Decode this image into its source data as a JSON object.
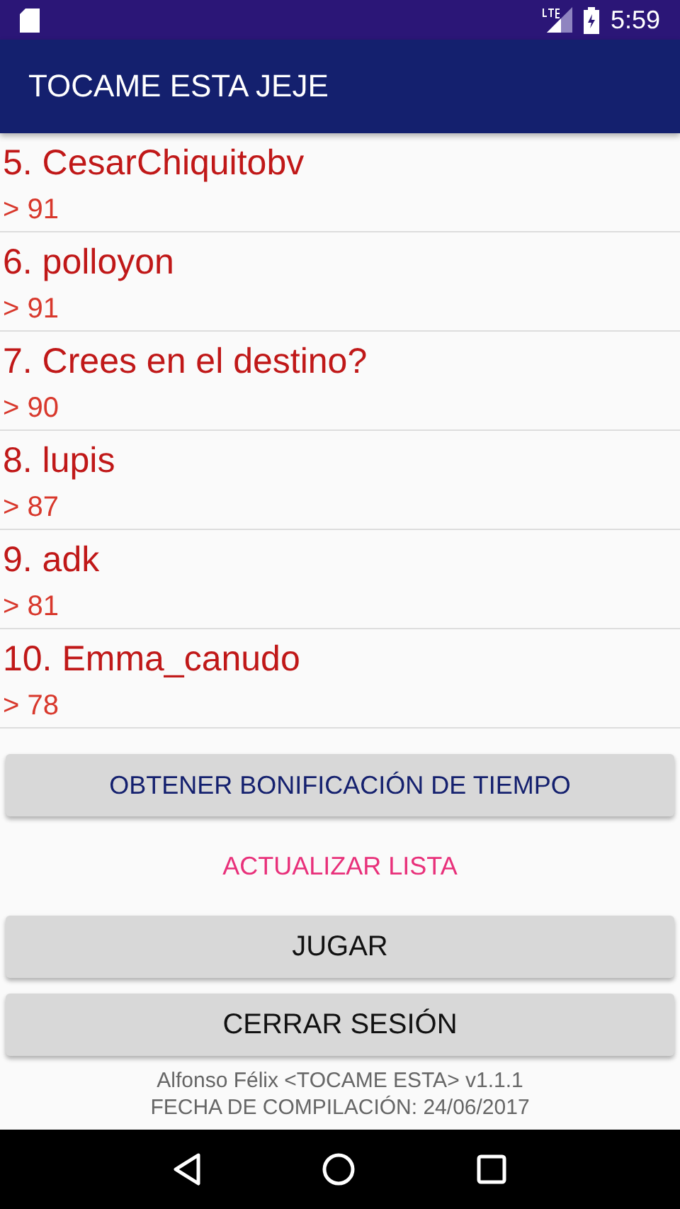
{
  "status_bar": {
    "time": "5:59"
  },
  "app_bar": {
    "title": "TOCAME ESTA JEJE"
  },
  "scores": [
    {
      "name": "5. CesarChiquitobv",
      "score": "> 91"
    },
    {
      "name": "6. polloyon",
      "score": "> 91"
    },
    {
      "name": "7. Crees en el destino?",
      "score": "> 90"
    },
    {
      "name": "8. lupis",
      "score": "> 87"
    },
    {
      "name": "9. adk",
      "score": "> 81"
    },
    {
      "name": "10. Emma_canudo",
      "score": "> 78"
    }
  ],
  "buttons": [
    {
      "label": "OBTENER BONIFICACIÓN DE TIEMPO",
      "kind": "raised-accent"
    },
    {
      "label": "ACTUALIZAR LISTA",
      "kind": "text"
    },
    {
      "label": "JUGAR",
      "kind": "raised"
    },
    {
      "label": "CERRAR SESIÓN",
      "kind": "raised"
    }
  ],
  "footer": [
    "Alfonso Félix <TOCAME ESTA> v1.1.1",
    "FECHA DE COMPILACIÓN: 24/06/2017"
  ]
}
